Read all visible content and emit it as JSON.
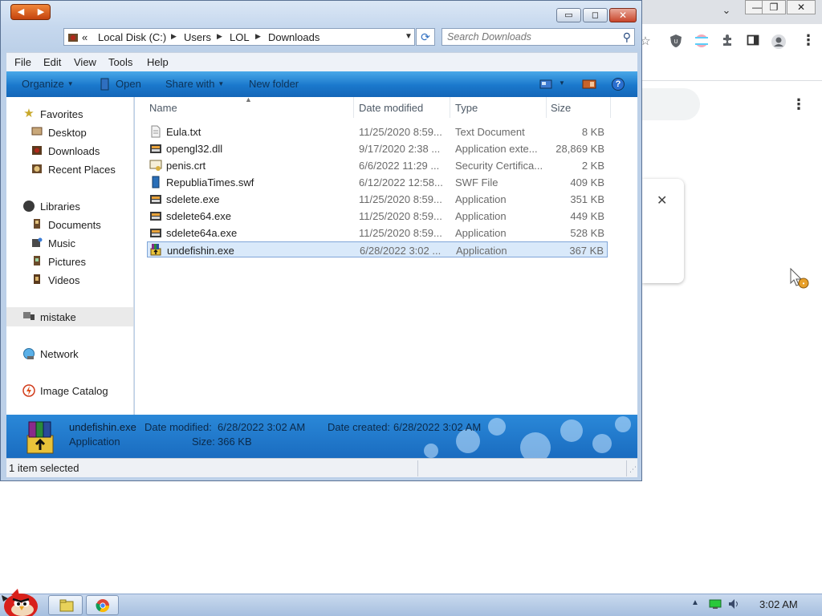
{
  "colors": {
    "command_bar": "#1a78cc",
    "details_pane": "#2a88d8",
    "selection": "#d9e9fa",
    "close_button": "#c8452b"
  },
  "window": {
    "minimize_glyph": "▭",
    "maximize_glyph": "◻",
    "close_glyph": "✕"
  },
  "address": {
    "overflow": "«",
    "crumbs": [
      "Local Disk (C:)",
      "Users",
      "LOL",
      "Downloads"
    ],
    "search_placeholder": "Search Downloads"
  },
  "menu": {
    "file": "File",
    "edit": "Edit",
    "view": "View",
    "tools": "Tools",
    "help": "Help"
  },
  "commands": {
    "organize": "Organize",
    "open": "Open",
    "share_with": "Share with",
    "new_folder": "New folder",
    "help_glyph": "?"
  },
  "nav": {
    "favorites": "Favorites",
    "desktop": "Desktop",
    "downloads": "Downloads",
    "recent_places": "Recent Places",
    "libraries": "Libraries",
    "documents": "Documents",
    "music": "Music",
    "pictures": "Pictures",
    "videos": "Videos",
    "mistake": "mistake",
    "network": "Network",
    "image_catalog": "Image Catalog"
  },
  "columns": {
    "name": "Name",
    "date_modified": "Date modified",
    "type": "Type",
    "size": "Size"
  },
  "files": [
    {
      "name": "Eula.txt",
      "date": "11/25/2020 8:59...",
      "type": "Text Document",
      "size": "8 KB",
      "icon": "text-file-icon"
    },
    {
      "name": "opengl32.dll",
      "date": "9/17/2020 2:38 ...",
      "type": "Application exte...",
      "size": "28,869 KB",
      "icon": "dll-file-icon"
    },
    {
      "name": "penis.crt",
      "date": "6/6/2022 11:29 ...",
      "type": "Security Certifica...",
      "size": "2 KB",
      "icon": "certificate-icon"
    },
    {
      "name": "RepubliaTimes.swf",
      "date": "6/12/2022 12:58...",
      "type": "SWF File",
      "size": "409 KB",
      "icon": "swf-file-icon"
    },
    {
      "name": "sdelete.exe",
      "date": "11/25/2020 8:59...",
      "type": "Application",
      "size": "351 KB",
      "icon": "exe-file-icon"
    },
    {
      "name": "sdelete64.exe",
      "date": "11/25/2020 8:59...",
      "type": "Application",
      "size": "449 KB",
      "icon": "exe-file-icon"
    },
    {
      "name": "sdelete64a.exe",
      "date": "11/25/2020 8:59...",
      "type": "Application",
      "size": "528 KB",
      "icon": "exe-file-icon"
    },
    {
      "name": "undefishin.exe",
      "date": "6/28/2022 3:02 ...",
      "type": "Application",
      "size": "367 KB",
      "icon": "installer-icon"
    }
  ],
  "details": {
    "name": "undefishin.exe",
    "type": "Application",
    "date_modified_label": "Date modified:",
    "date_modified": "6/28/2022 3:02 AM",
    "date_created_label": "Date created:",
    "date_created": "6/28/2022 3:02 AM",
    "size_label": "Size:",
    "size": "366 KB"
  },
  "status": {
    "text": "1 item selected"
  },
  "taskbar": {
    "time": "3:02 AM"
  },
  "browser": {
    "close_glyph": "✕",
    "min_glyph": "—",
    "restore_glyph": "❐",
    "menu_glyph": "⋮",
    "star_glyph": "☆",
    "ext_ublock": "U",
    "puzzle_glyph": "✱"
  }
}
